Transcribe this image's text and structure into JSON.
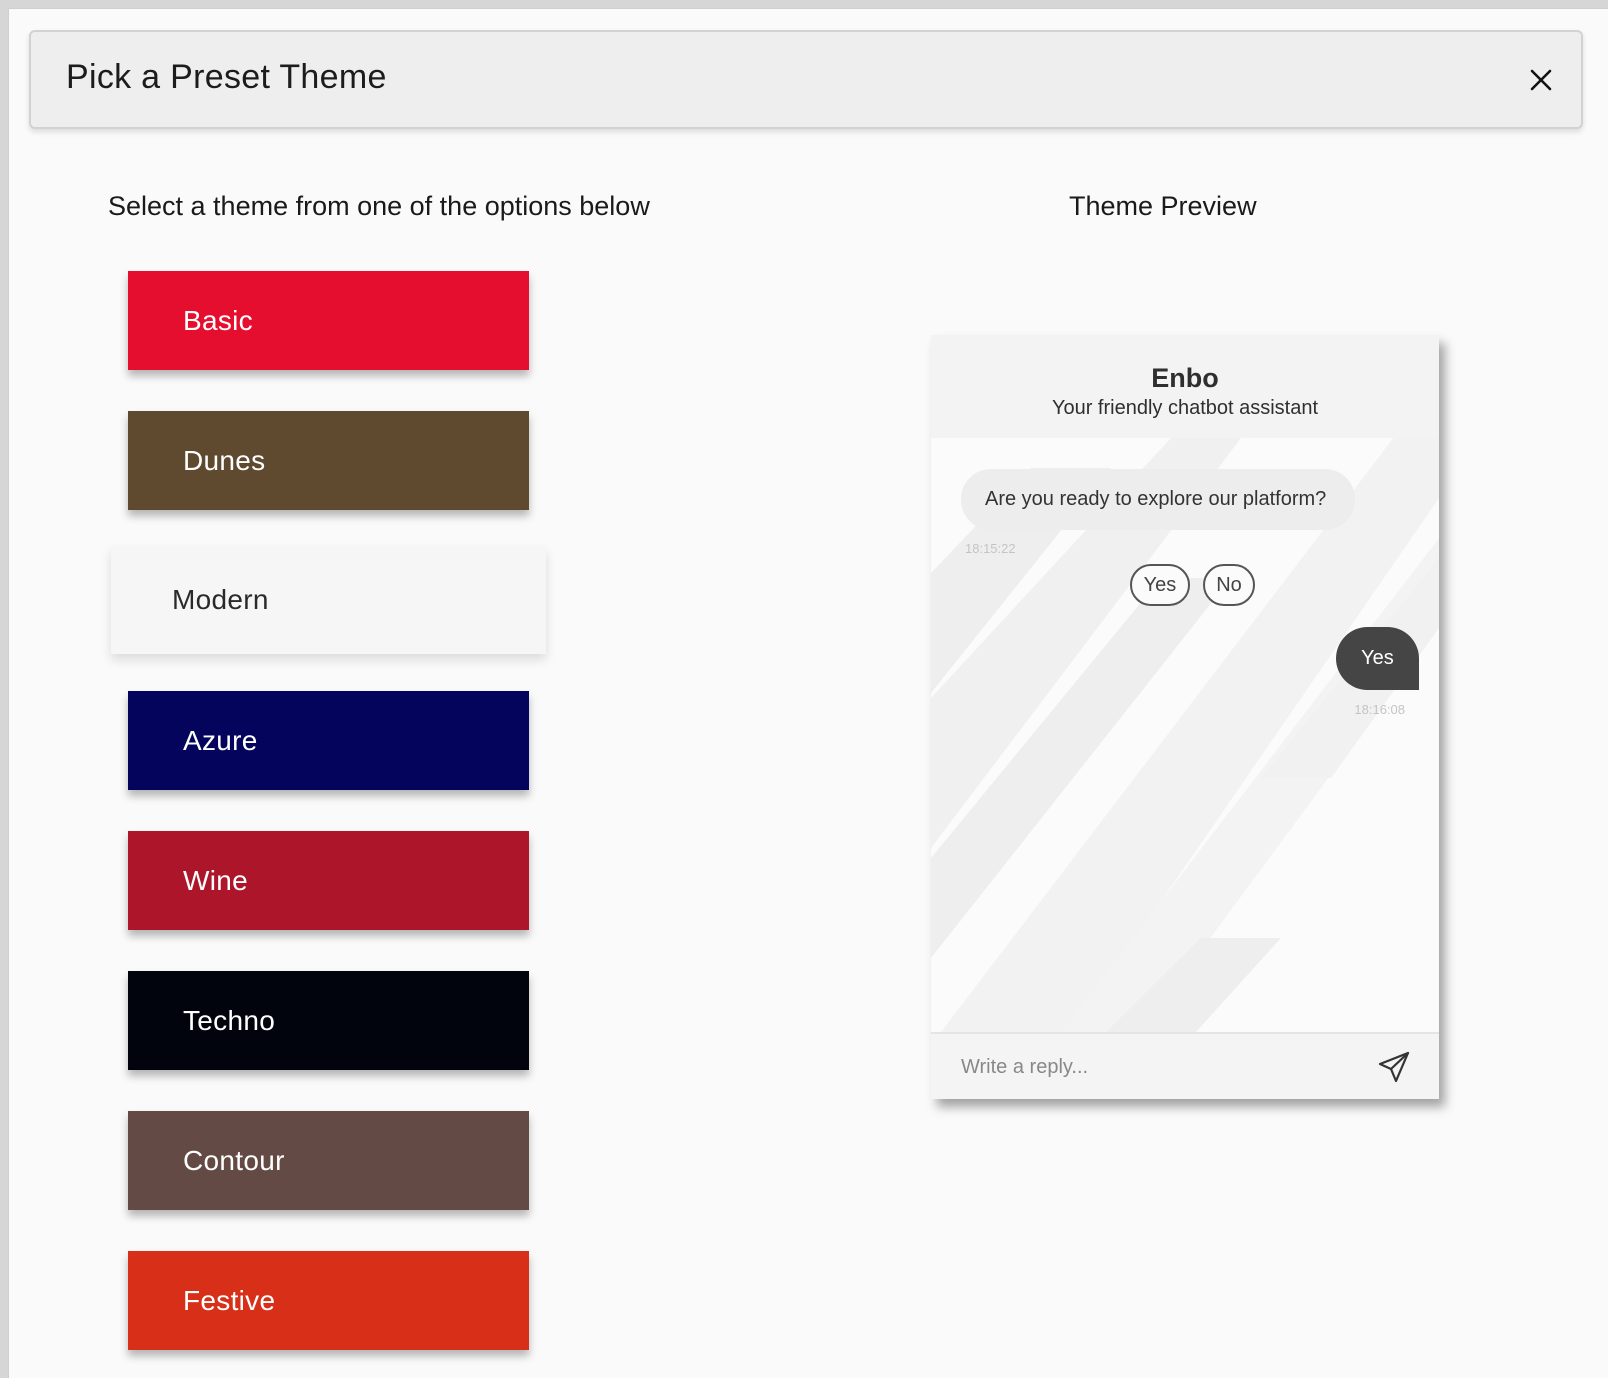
{
  "modal": {
    "title": "Pick a Preset Theme",
    "close_icon": "close-icon"
  },
  "instructions": "Select a theme from one of the options below",
  "preview_heading": "Theme Preview",
  "themes": [
    {
      "label": "Basic",
      "color": "#e60e2e"
    },
    {
      "label": "Dunes",
      "color": "#5f4a30"
    },
    {
      "label": "Modern",
      "color": "#f6f6f6"
    },
    {
      "label": "Azure",
      "color": "#04045c"
    },
    {
      "label": "Wine",
      "color": "#ad162a"
    },
    {
      "label": "Techno",
      "color": "#02040d"
    },
    {
      "label": "Contour",
      "color": "#644a44"
    },
    {
      "label": "Festive",
      "color": "#d72f18"
    }
  ],
  "preview": {
    "bot_name": "Enbo",
    "bot_tagline": "Your friendly chatbot assistant",
    "bot_message": "Are you ready to explore our platform?",
    "bot_timestamp": "18:15:22",
    "quick_replies": [
      "Yes",
      "No"
    ],
    "user_message": "Yes",
    "user_timestamp": "18:16:08",
    "reply_placeholder": "Write a reply...",
    "send_icon": "send-icon"
  }
}
